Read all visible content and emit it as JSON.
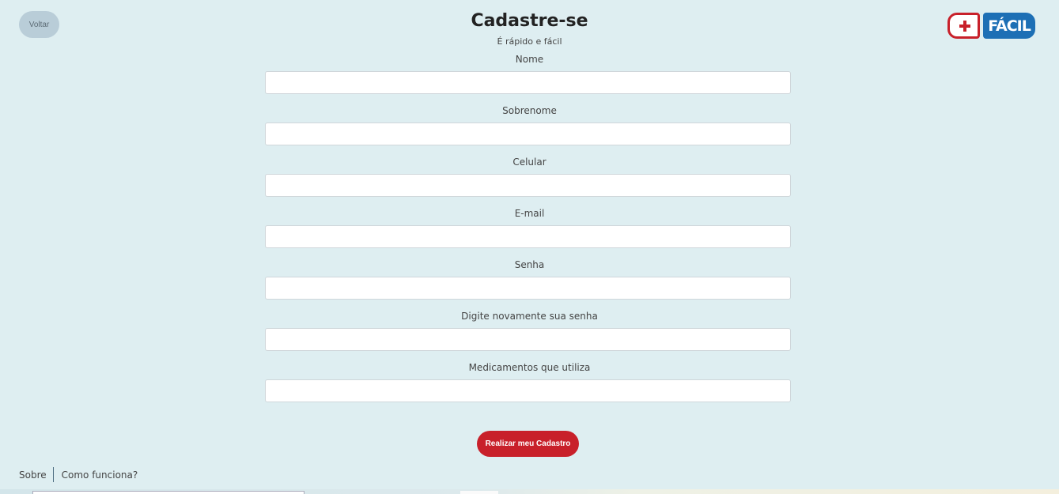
{
  "header": {
    "back_label": "Voltar",
    "title": "Cadastre-se",
    "subtitle": "É rápido e fácil",
    "logo_text": "FÁCIL"
  },
  "form": {
    "fields": [
      {
        "label": "Nome",
        "value": ""
      },
      {
        "label": "Sobrenome",
        "value": ""
      },
      {
        "label": "Celular",
        "value": ""
      },
      {
        "label": "E-mail",
        "value": ""
      },
      {
        "label": "Senha",
        "value": ""
      },
      {
        "label": "Digite novamente sua senha",
        "value": ""
      },
      {
        "label": "Medicamentos que utiliza",
        "value": ""
      }
    ],
    "submit_label": "Realizar meu Cadastro"
  },
  "footer": {
    "links": [
      "Sobre",
      "Como funciona?"
    ]
  },
  "colors": {
    "background": "#deeef1",
    "accent_red": "#c8202a",
    "logo_blue": "#1d6fb5",
    "back_button": "#b9cdd8"
  },
  "icons": {
    "logo_symbol": "plus-cross-icon"
  }
}
